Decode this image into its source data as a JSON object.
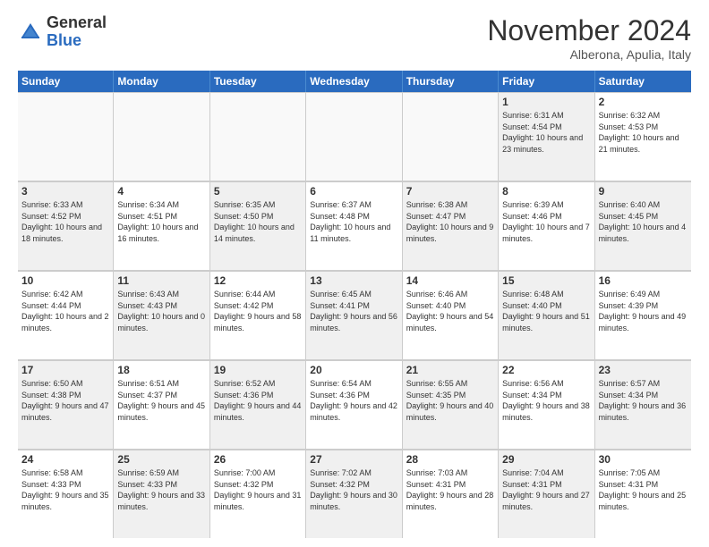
{
  "header": {
    "logo_general": "General",
    "logo_blue": "Blue",
    "month_title": "November 2024",
    "subtitle": "Alberona, Apulia, Italy"
  },
  "days_of_week": [
    "Sunday",
    "Monday",
    "Tuesday",
    "Wednesday",
    "Thursday",
    "Friday",
    "Saturday"
  ],
  "weeks": [
    [
      {
        "day": "",
        "info": "",
        "empty": true
      },
      {
        "day": "",
        "info": "",
        "empty": true
      },
      {
        "day": "",
        "info": "",
        "empty": true
      },
      {
        "day": "",
        "info": "",
        "empty": true
      },
      {
        "day": "",
        "info": "",
        "empty": true
      },
      {
        "day": "1",
        "info": "Sunrise: 6:31 AM\nSunset: 4:54 PM\nDaylight: 10 hours and 23 minutes.",
        "shaded": true
      },
      {
        "day": "2",
        "info": "Sunrise: 6:32 AM\nSunset: 4:53 PM\nDaylight: 10 hours and 21 minutes.",
        "shaded": false
      }
    ],
    [
      {
        "day": "3",
        "info": "Sunrise: 6:33 AM\nSunset: 4:52 PM\nDaylight: 10 hours and 18 minutes.",
        "shaded": true
      },
      {
        "day": "4",
        "info": "Sunrise: 6:34 AM\nSunset: 4:51 PM\nDaylight: 10 hours and 16 minutes.",
        "shaded": false
      },
      {
        "day": "5",
        "info": "Sunrise: 6:35 AM\nSunset: 4:50 PM\nDaylight: 10 hours and 14 minutes.",
        "shaded": true
      },
      {
        "day": "6",
        "info": "Sunrise: 6:37 AM\nSunset: 4:48 PM\nDaylight: 10 hours and 11 minutes.",
        "shaded": false
      },
      {
        "day": "7",
        "info": "Sunrise: 6:38 AM\nSunset: 4:47 PM\nDaylight: 10 hours and 9 minutes.",
        "shaded": true
      },
      {
        "day": "8",
        "info": "Sunrise: 6:39 AM\nSunset: 4:46 PM\nDaylight: 10 hours and 7 minutes.",
        "shaded": false
      },
      {
        "day": "9",
        "info": "Sunrise: 6:40 AM\nSunset: 4:45 PM\nDaylight: 10 hours and 4 minutes.",
        "shaded": true
      }
    ],
    [
      {
        "day": "10",
        "info": "Sunrise: 6:42 AM\nSunset: 4:44 PM\nDaylight: 10 hours and 2 minutes.",
        "shaded": false
      },
      {
        "day": "11",
        "info": "Sunrise: 6:43 AM\nSunset: 4:43 PM\nDaylight: 10 hours and 0 minutes.",
        "shaded": true
      },
      {
        "day": "12",
        "info": "Sunrise: 6:44 AM\nSunset: 4:42 PM\nDaylight: 9 hours and 58 minutes.",
        "shaded": false
      },
      {
        "day": "13",
        "info": "Sunrise: 6:45 AM\nSunset: 4:41 PM\nDaylight: 9 hours and 56 minutes.",
        "shaded": true
      },
      {
        "day": "14",
        "info": "Sunrise: 6:46 AM\nSunset: 4:40 PM\nDaylight: 9 hours and 54 minutes.",
        "shaded": false
      },
      {
        "day": "15",
        "info": "Sunrise: 6:48 AM\nSunset: 4:40 PM\nDaylight: 9 hours and 51 minutes.",
        "shaded": true
      },
      {
        "day": "16",
        "info": "Sunrise: 6:49 AM\nSunset: 4:39 PM\nDaylight: 9 hours and 49 minutes.",
        "shaded": false
      }
    ],
    [
      {
        "day": "17",
        "info": "Sunrise: 6:50 AM\nSunset: 4:38 PM\nDaylight: 9 hours and 47 minutes.",
        "shaded": true
      },
      {
        "day": "18",
        "info": "Sunrise: 6:51 AM\nSunset: 4:37 PM\nDaylight: 9 hours and 45 minutes.",
        "shaded": false
      },
      {
        "day": "19",
        "info": "Sunrise: 6:52 AM\nSunset: 4:36 PM\nDaylight: 9 hours and 44 minutes.",
        "shaded": true
      },
      {
        "day": "20",
        "info": "Sunrise: 6:54 AM\nSunset: 4:36 PM\nDaylight: 9 hours and 42 minutes.",
        "shaded": false
      },
      {
        "day": "21",
        "info": "Sunrise: 6:55 AM\nSunset: 4:35 PM\nDaylight: 9 hours and 40 minutes.",
        "shaded": true
      },
      {
        "day": "22",
        "info": "Sunrise: 6:56 AM\nSunset: 4:34 PM\nDaylight: 9 hours and 38 minutes.",
        "shaded": false
      },
      {
        "day": "23",
        "info": "Sunrise: 6:57 AM\nSunset: 4:34 PM\nDaylight: 9 hours and 36 minutes.",
        "shaded": true
      }
    ],
    [
      {
        "day": "24",
        "info": "Sunrise: 6:58 AM\nSunset: 4:33 PM\nDaylight: 9 hours and 35 minutes.",
        "shaded": false
      },
      {
        "day": "25",
        "info": "Sunrise: 6:59 AM\nSunset: 4:33 PM\nDaylight: 9 hours and 33 minutes.",
        "shaded": true
      },
      {
        "day": "26",
        "info": "Sunrise: 7:00 AM\nSunset: 4:32 PM\nDaylight: 9 hours and 31 minutes.",
        "shaded": false
      },
      {
        "day": "27",
        "info": "Sunrise: 7:02 AM\nSunset: 4:32 PM\nDaylight: 9 hours and 30 minutes.",
        "shaded": true
      },
      {
        "day": "28",
        "info": "Sunrise: 7:03 AM\nSunset: 4:31 PM\nDaylight: 9 hours and 28 minutes.",
        "shaded": false
      },
      {
        "day": "29",
        "info": "Sunrise: 7:04 AM\nSunset: 4:31 PM\nDaylight: 9 hours and 27 minutes.",
        "shaded": true
      },
      {
        "day": "30",
        "info": "Sunrise: 7:05 AM\nSunset: 4:31 PM\nDaylight: 9 hours and 25 minutes.",
        "shaded": false
      }
    ]
  ]
}
